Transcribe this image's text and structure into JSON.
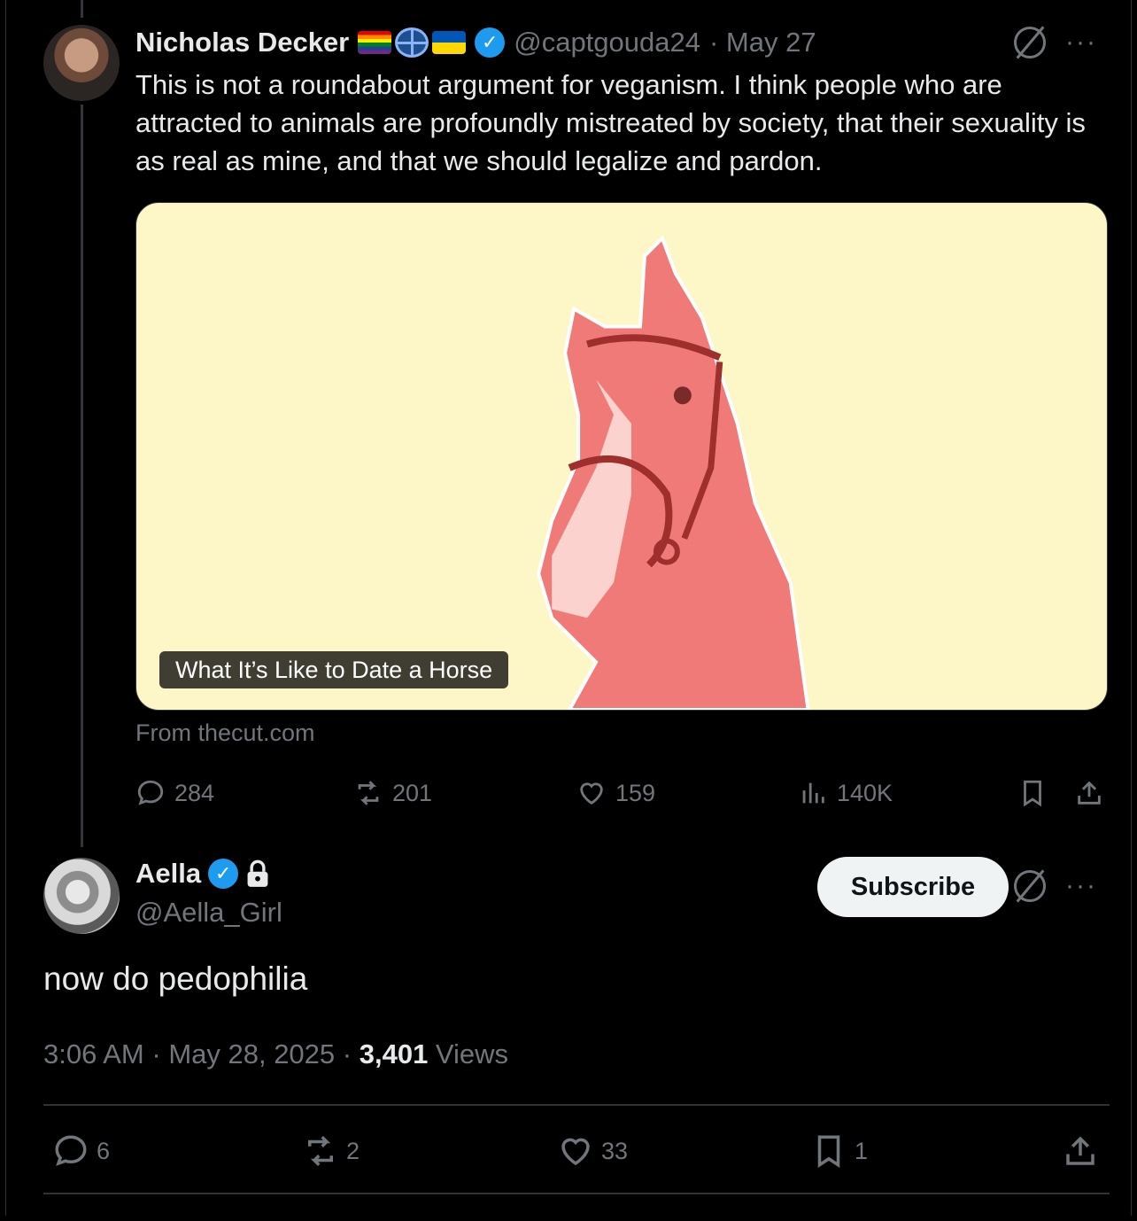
{
  "tweet1": {
    "name": "Nicholas Decker",
    "handle": "@captgouda24",
    "date": "· May 27",
    "text": "This is not a roundabout argument for veganism. I think people who are attracted to animals are profoundly mistreated by society, that their sexuality is as real as mine, and that we should legalize and pardon.",
    "card_title": "What It’s Like to Date a Horse",
    "card_source": "From thecut.com",
    "replies": "284",
    "reposts": "201",
    "likes": "159",
    "views": "140K",
    "badges": [
      "rainbow-flag",
      "globe-icon",
      "ukraine-flag",
      "verified-badge"
    ]
  },
  "tweet2": {
    "name": "Aella",
    "handle": "@Aella_Girl",
    "subscribe_label": "Subscribe",
    "text": "now do pedophilia",
    "time": "3:06 AM",
    "date_sep": " · ",
    "date": "May 28, 2025",
    "views_sep": " · ",
    "views_count": "3,401",
    "views_label": " Views",
    "replies": "6",
    "reposts": "2",
    "likes": "33",
    "bookmarks": "1"
  },
  "colors": {
    "background": "#000000",
    "text": "#e7e9ea",
    "muted": "#71767b",
    "verified": "#1d9bf0",
    "card_bg": "#fdf7c8",
    "horse": "#f07a78"
  }
}
